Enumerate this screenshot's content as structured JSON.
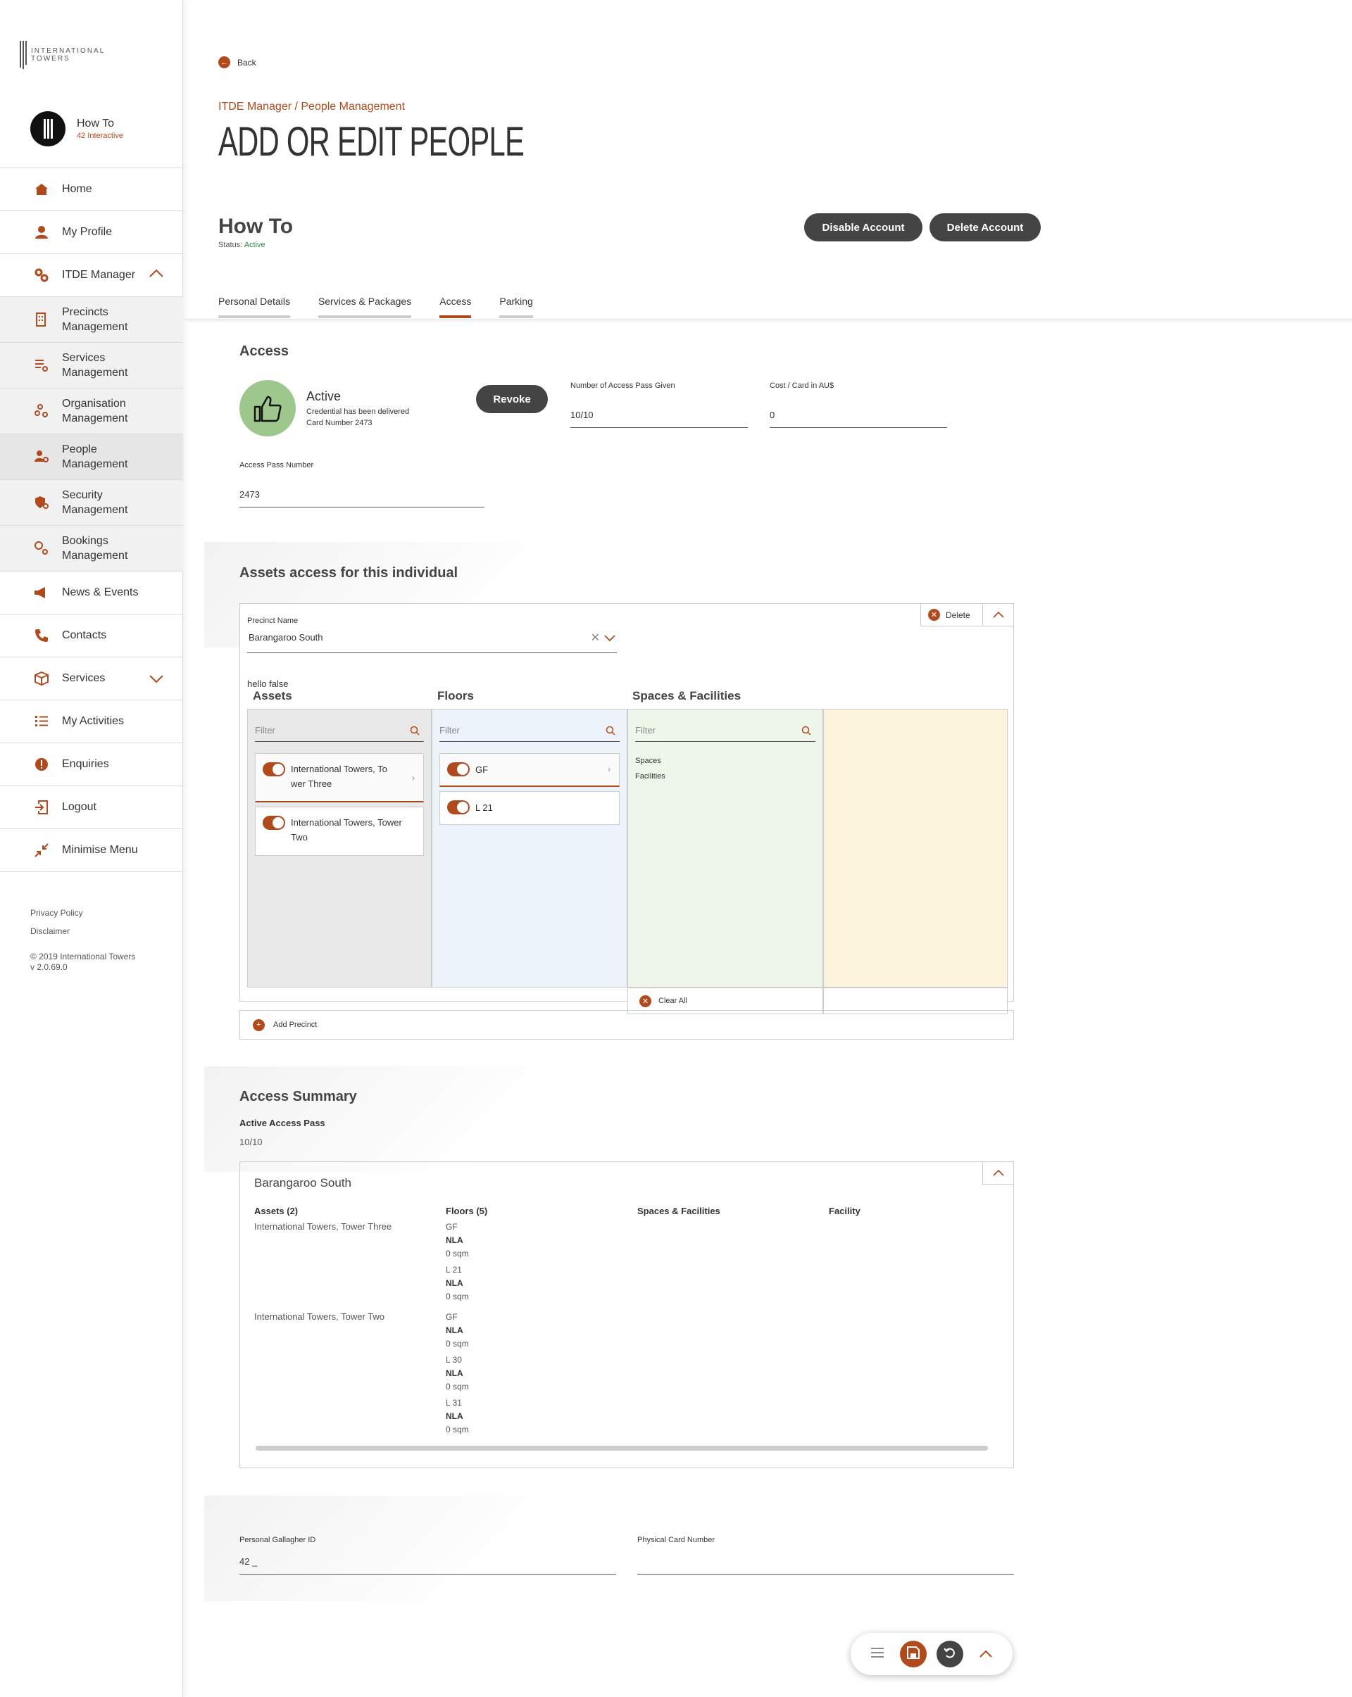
{
  "brand": {
    "logo_text": "INTERNATIONAL TOWERS",
    "accent": "#b04a1c"
  },
  "user": {
    "name": "How To",
    "org": "42 Interactive"
  },
  "nav": {
    "home": "Home",
    "profile": "My Profile",
    "itde": "ITDE Manager",
    "precincts": [
      "Precincts",
      "Management"
    ],
    "services_mgmt": [
      "Services",
      "Management"
    ],
    "organisation": [
      "Organisation",
      "Management"
    ],
    "people": [
      "People",
      "Management"
    ],
    "security": [
      "Security",
      "Management"
    ],
    "bookings": [
      "Bookings",
      "Management"
    ],
    "news": "News & Events",
    "contacts": "Contacts",
    "services": "Services",
    "activities": "My Activities",
    "enquiries": "Enquiries",
    "logout": "Logout",
    "minimise": "Minimise Menu"
  },
  "legal": {
    "privacy": "Privacy Policy",
    "disclaimer": "Disclaimer",
    "copyright": "© 2019 International Towers",
    "version": "v 2.0.69.0"
  },
  "header": {
    "back": "Back",
    "breadcrumb": "ITDE Manager / People Management",
    "title": "ADD OR EDIT PEOPLE",
    "person": "How To",
    "status_label": "Status:",
    "status_value": "Active",
    "disable": "Disable Account",
    "delete": "Delete Account"
  },
  "tabs": [
    "Personal Details",
    "Services & Packages",
    "Access",
    "Parking"
  ],
  "access": {
    "title": "Access",
    "state": "Active",
    "delivered": "Credential has been delivered",
    "card": "Card Number 2473",
    "revoke": "Revoke",
    "num_label": "Number of Access Pass Given",
    "num_value": "10/10",
    "cost_label": "Cost / Card in AU$",
    "cost_value": "0",
    "pass_label": "Access Pass Number",
    "pass_value": "2473"
  },
  "assets": {
    "title": "Assets access for this individual",
    "delete": "Delete",
    "precinct_label": "Precinct Name",
    "precinct_value": "Barangaroo South",
    "debug": "hello false",
    "col_assets": "Assets",
    "col_floors": "Floors",
    "col_spaces": "Spaces & Facilities",
    "filter": "Filter",
    "asset_items": [
      [
        "International Towers, To",
        "wer Three"
      ],
      [
        "International Towers, Tower",
        "Two"
      ]
    ],
    "floor_items": [
      "GF",
      "L 21"
    ],
    "spaces": "Spaces",
    "facilities": "Facilities",
    "clear_all": "Clear All",
    "add_precinct": "Add Precinct"
  },
  "summary": {
    "title": "Access Summary",
    "active_label": "Active Access Pass",
    "active_value": "10/10",
    "precinct": "Barangaroo South",
    "h_assets": "Assets (2)",
    "h_floors": "Floors (5)",
    "h_spaces": "Spaces & Facilities",
    "h_facility": "Facility",
    "asset1": "International Towers, Tower Three",
    "asset2": "International Towers, Tower Two",
    "nla": "NLA",
    "sqm": "0 sqm",
    "floors1": [
      "GF",
      "L 21"
    ],
    "floors2": [
      "GF",
      "L 30",
      "L 31"
    ]
  },
  "ids": {
    "gallagher_label": "Personal Gallagher ID",
    "gallagher_value": "42 _",
    "physical_label": "Physical Card Number",
    "physical_value": ""
  }
}
